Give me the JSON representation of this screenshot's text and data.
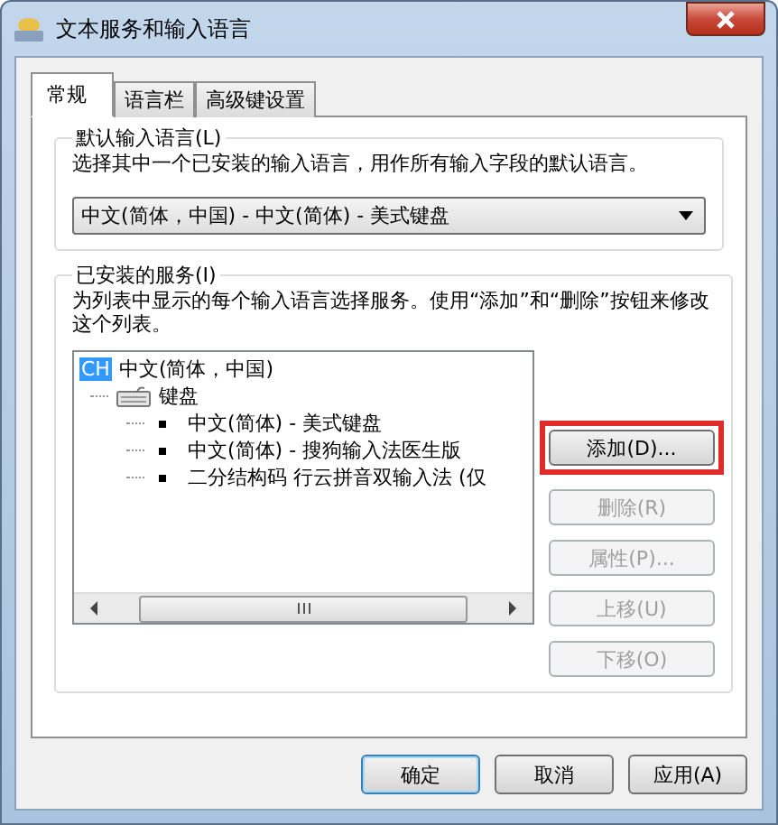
{
  "window": {
    "title": "文本服务和输入语言"
  },
  "tabs": [
    {
      "label": "常规",
      "selected": true
    },
    {
      "label": "语言栏",
      "selected": false
    },
    {
      "label": "高级键设置",
      "selected": false
    }
  ],
  "default_language": {
    "legend": "默认输入语言(L)",
    "description": "选择其中一个已安装的输入语言，用作所有输入字段的默认语言。",
    "dropdown": {
      "value": "中文(简体，中国) - 中文(简体) - 美式键盘"
    }
  },
  "installed_services": {
    "legend": "已安装的服务(I)",
    "description": "为列表中显示的每个输入语言选择服务。使用“添加”和“删除”按钮来修改这个列表。",
    "tree": [
      {
        "kind": "language",
        "badge": "CH",
        "label": "中文(简体，中国)",
        "children": [
          {
            "kind": "category",
            "label": "键盘",
            "children": [
              {
                "kind": "item",
                "label": "中文(简体) - 美式键盘"
              },
              {
                "kind": "item",
                "label": "中文(简体) - 搜狗输入法医生版"
              },
              {
                "kind": "item",
                "label": "二分结构码 行云拼音双输入法 (仅"
              }
            ]
          }
        ]
      }
    ],
    "buttons": [
      {
        "label": "添加(D)...",
        "disabled": false,
        "highlighted": true
      },
      {
        "label": "删除(R)",
        "disabled": true,
        "highlighted": false
      },
      {
        "label": "属性(P)...",
        "disabled": true,
        "highlighted": false
      },
      {
        "label": "上移(U)",
        "disabled": true,
        "highlighted": false
      },
      {
        "label": "下移(O)",
        "disabled": true,
        "highlighted": false
      }
    ]
  },
  "footer_buttons": [
    {
      "label": "确定",
      "default": true
    },
    {
      "label": "取消",
      "default": false
    },
    {
      "label": "应用(A)",
      "default": false
    }
  ]
}
